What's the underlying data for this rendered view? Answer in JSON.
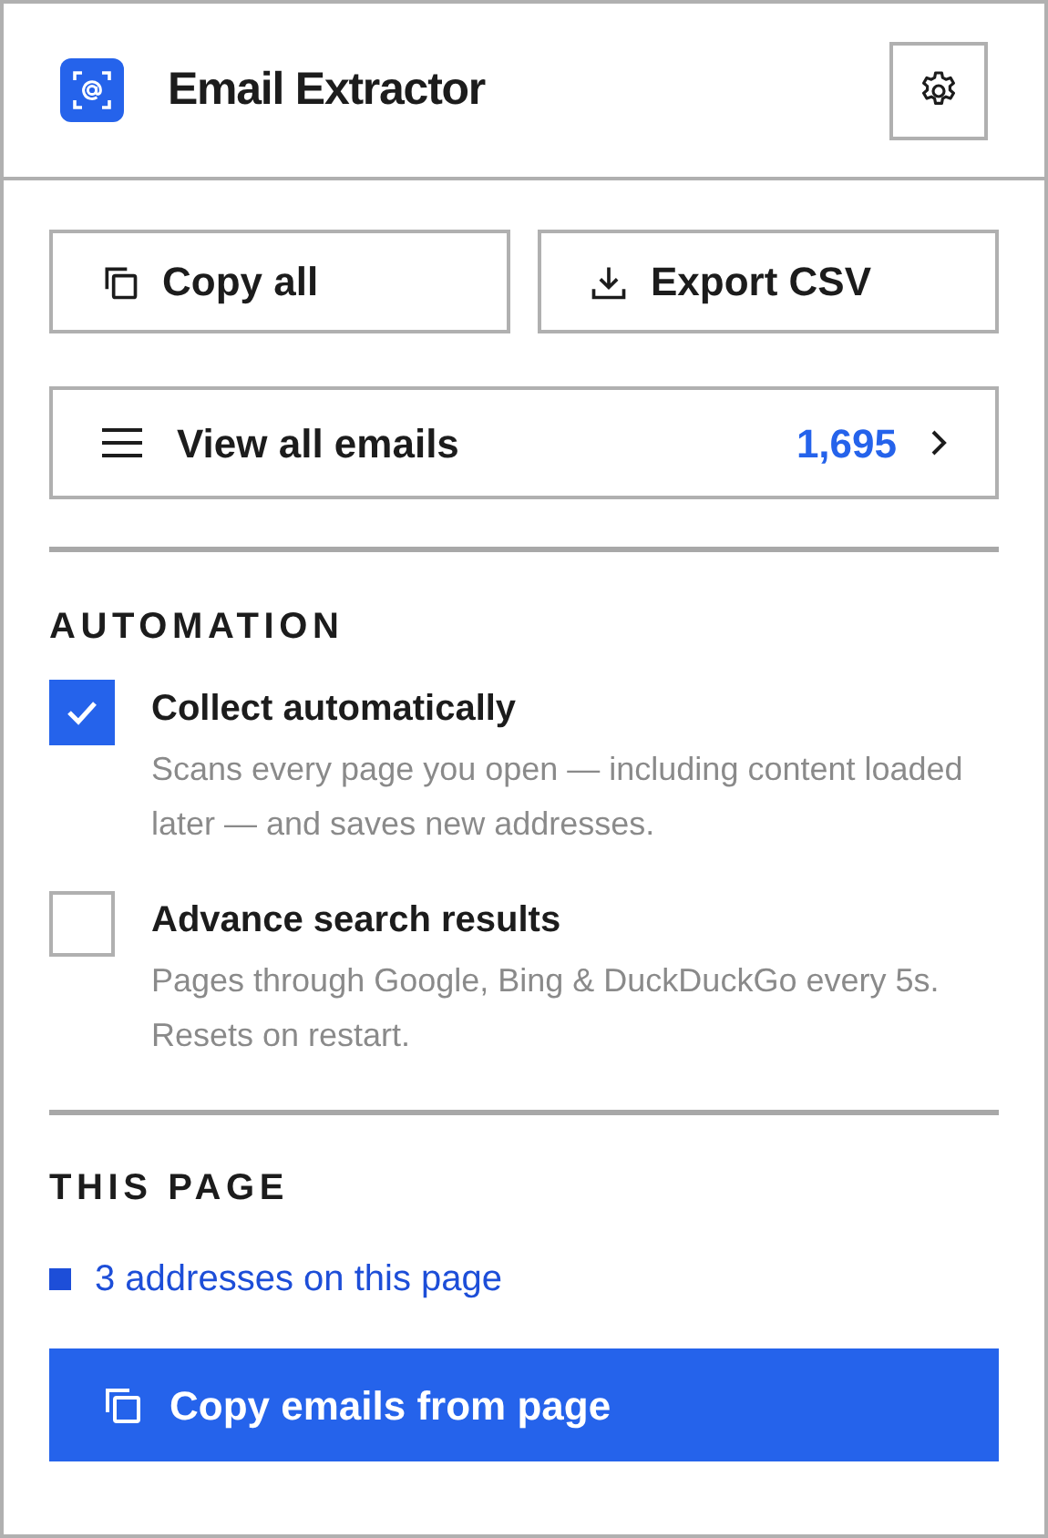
{
  "header": {
    "title": "Email Extractor"
  },
  "actions": [
    {
      "label": "Copy all",
      "kind": "copy"
    },
    {
      "label": "Export CSV",
      "kind": "download"
    }
  ],
  "view_all": {
    "label": "View all emails",
    "count": "1,695"
  },
  "automation": {
    "heading": "AUTOMATION",
    "options": [
      {
        "label": "Collect automatically",
        "description": "Scans every page you open — including content loaded later — and saves new addresses.",
        "checked": true
      },
      {
        "label": "Advance search results",
        "description": "Pages through Google, Bing & DuckDuckGo every 5s. Resets on restart.",
        "checked": false
      }
    ]
  },
  "this_page": {
    "heading": "THIS PAGE",
    "link": "3 addresses on this page",
    "button": "Copy emails from page"
  }
}
